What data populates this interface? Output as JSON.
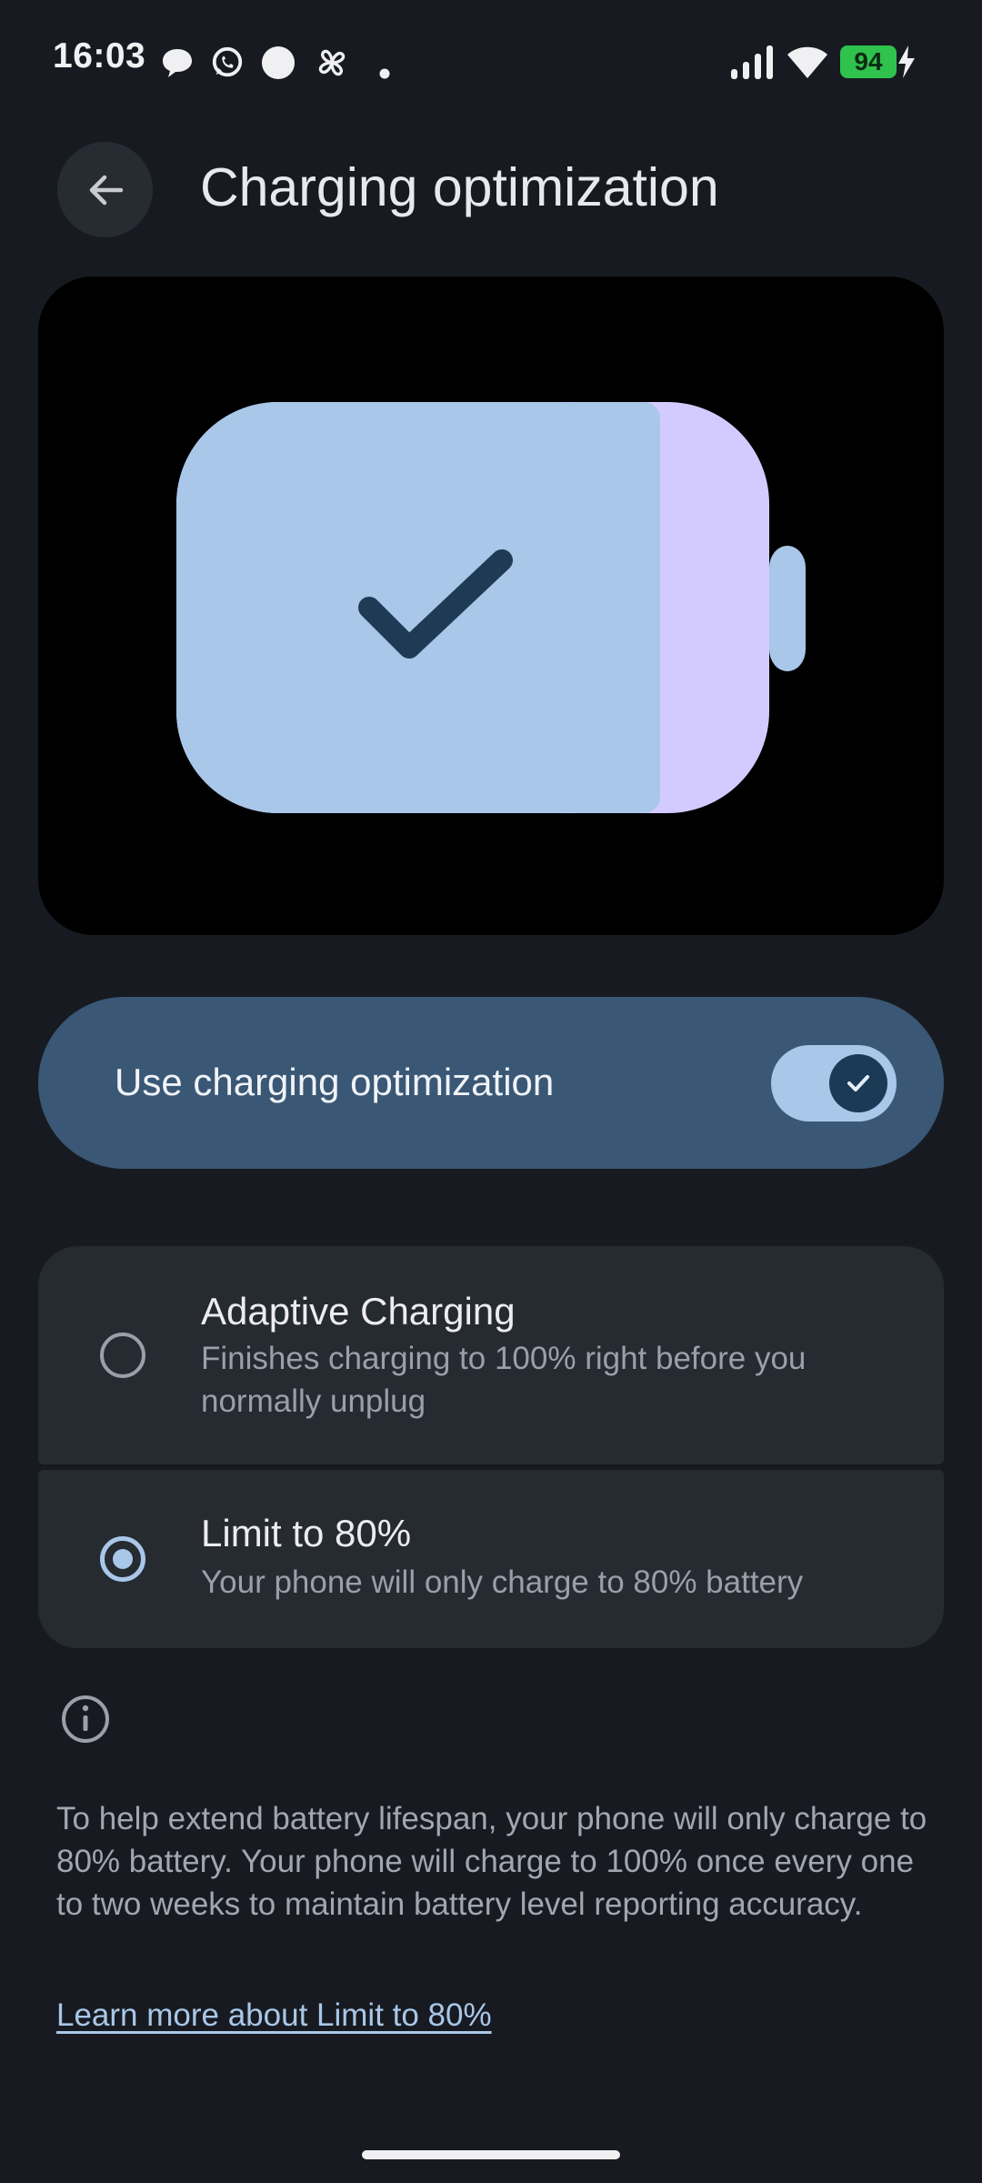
{
  "status_bar": {
    "time": "16:03",
    "battery_level": "94",
    "notification_icons": [
      "chat-bubble-icon",
      "whatsapp-icon",
      "circle-icon",
      "pinwheel-icon",
      "dot-icon"
    ],
    "system_icons": [
      "signal-icon",
      "wifi-icon",
      "battery-icon",
      "charging-bolt-icon"
    ]
  },
  "header": {
    "title": "Charging optimization"
  },
  "illustration": {
    "icon": "battery-check-icon",
    "colors": {
      "primary": "#a9c7e8",
      "secondary": "#d3cbff",
      "check": "#1e3a55"
    }
  },
  "main_toggle": {
    "label": "Use charging optimization",
    "enabled": true
  },
  "options": [
    {
      "title": "Adaptive Charging",
      "subtitle": "Finishes charging to 100% right before you normally unplug",
      "selected": false
    },
    {
      "title": "Limit to 80%",
      "subtitle": "Your phone will only charge to 80% battery",
      "selected": true
    }
  ],
  "info": {
    "text": "To help extend battery lifespan, your phone will only charge to 80% battery. Your phone will charge to 100% once every one to two weeks to maintain battery level reporting accuracy.",
    "link_label": "Learn more about Limit to 80%"
  },
  "colors": {
    "background": "#171b21",
    "accent": "#a9c7e8",
    "toggle_container": "#3a5775",
    "card": "#262a31",
    "battery_indicator": "#2fc24d"
  }
}
